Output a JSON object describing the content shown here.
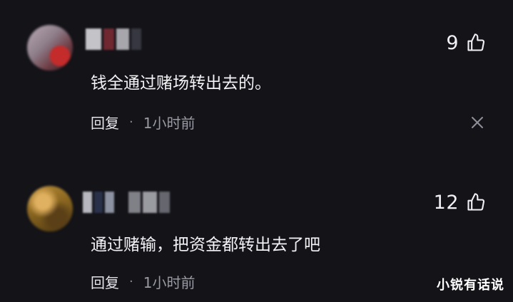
{
  "comments": [
    {
      "like_count": "9",
      "text": "钱全通过赌场转出去的。",
      "reply_label": "回复",
      "separator": "·",
      "time": "1小时前"
    },
    {
      "like_count": "12",
      "text": "通过赌输，把资金都转出去了吧",
      "reply_label": "回复",
      "separator": "·",
      "time": "1小时前"
    }
  ],
  "watermark": "小锐有话说",
  "icons": {
    "like": "thumbs-up-icon",
    "dismiss": "close-icon"
  },
  "colors": {
    "background": "#131318",
    "text": "#f3f3f6",
    "muted": "#9a9aa4"
  }
}
